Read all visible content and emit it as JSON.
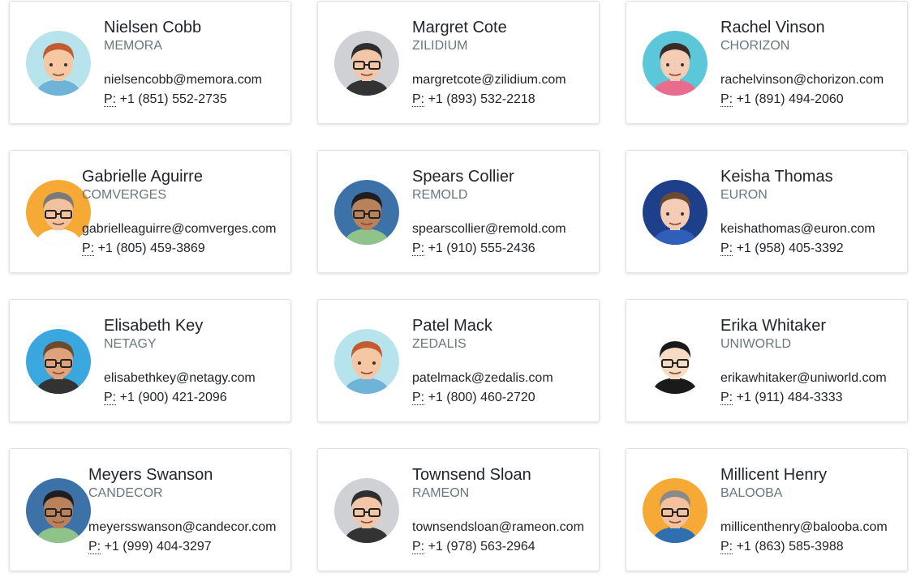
{
  "phone_prefix": "P:",
  "contacts": [
    {
      "name": "Nielsen Cobb",
      "company": "MEMORA",
      "email": "nielsencobb@memora.com",
      "phone": "+1 (851) 552-2735",
      "avatar": "avatar-redhair-man",
      "bg": "#b7e3ec",
      "skin": "#f7c7a3",
      "hair": "#c25b30",
      "shirt": "#6fb3d8",
      "glasses": false
    },
    {
      "name": "Margret Cote",
      "company": "ZILIDIUM",
      "email": "margretcote@zilidium.com",
      "phone": "+1 (893) 532-2218",
      "avatar": "avatar-glasses-man",
      "bg": "#cfd1d5",
      "skin": "#f2c6a6",
      "hair": "#2e2e2e",
      "shirt": "#333333",
      "glasses": true
    },
    {
      "name": "Rachel Vinson",
      "company": "CHORIZON",
      "email": "rachelvinson@chorizon.com",
      "phone": "+1 (891) 494-2060",
      "avatar": "avatar-woman-brown-hair",
      "bg": "#5cc7d9",
      "skin": "#f5cdb4",
      "hair": "#3a2b24",
      "shirt": "#e86c8e",
      "glasses": false
    },
    {
      "name": "Gabrielle Aguirre",
      "company": "COMVERGES",
      "email": "gabrielleaguirre@comverges.com",
      "phone": "+1 (805) 459-3869",
      "avatar": "avatar-bald-glasses-man",
      "bg": "#f7a935",
      "skin": "#f2c29e",
      "hair": "#7a7a7a",
      "shirt": "#ffffff",
      "glasses": true
    },
    {
      "name": "Spears Collier",
      "company": "REMOLD",
      "email": "spearscollier@remold.com",
      "phone": "+1 (910) 555-2436",
      "avatar": "avatar-dark-glasses-man",
      "bg": "#3d72a8",
      "skin": "#b9825a",
      "hair": "#1e1e1e",
      "shirt": "#8fc38a",
      "glasses": true
    },
    {
      "name": "Keisha Thomas",
      "company": "EURON",
      "email": "keishathomas@euron.com",
      "phone": "+1 (958) 405-3392",
      "avatar": "avatar-woman-stars",
      "bg": "#1e3f8a",
      "skin": "#f5cdb4",
      "hair": "#6b4a33",
      "shirt": "#2f5fb8",
      "glasses": false
    },
    {
      "name": "Elisabeth Key",
      "company": "NETAGY",
      "email": "elisabethkey@netagy.com",
      "phone": "+1 (900) 421-2096",
      "avatar": "avatar-sunglasses-man",
      "bg": "#3aa7de",
      "skin": "#e0a27a",
      "hair": "#6b4a2f",
      "shirt": "#333333",
      "glasses": true
    },
    {
      "name": "Patel Mack",
      "company": "ZEDALIS",
      "email": "patelmack@zedalis.com",
      "phone": "+1 (800) 460-2720",
      "avatar": "avatar-redhair-man",
      "bg": "#b7e3ec",
      "skin": "#f7c7a3",
      "hair": "#c25b30",
      "shirt": "#6fb3d8",
      "glasses": false
    },
    {
      "name": "Erika Whitaker",
      "company": "UNIWORLD",
      "email": "erikawhitaker@uniworld.com",
      "phone": "+1 (911) 484-3333",
      "avatar": "avatar-cartoon-glasses-man",
      "bg": "#ffffff",
      "skin": "#f7dcc4",
      "hair": "#1a1a1a",
      "shirt": "#1a1a1a",
      "glasses": true
    },
    {
      "name": "Meyers Swanson",
      "company": "CANDECOR",
      "email": "meyersswanson@candecor.com",
      "phone": "+1 (999) 404-3297",
      "avatar": "avatar-dark-glasses-man",
      "bg": "#3d72a8",
      "skin": "#b9825a",
      "hair": "#1e1e1e",
      "shirt": "#8fc38a",
      "glasses": true
    },
    {
      "name": "Townsend Sloan",
      "company": "RAMEON",
      "email": "townsendsloan@rameon.com",
      "phone": "+1 (978) 563-2964",
      "avatar": "avatar-glasses-man",
      "bg": "#cfd1d5",
      "skin": "#f2c6a6",
      "hair": "#2e2e2e",
      "shirt": "#333333",
      "glasses": true
    },
    {
      "name": "Millicent Henry",
      "company": "BALOOBA",
      "email": "millicenthenry@balooba.com",
      "phone": "+1 (863) 585-3988",
      "avatar": "avatar-grey-hair-glasses-man",
      "bg": "#f7a935",
      "skin": "#f2c29e",
      "hair": "#8a8a8a",
      "shirt": "#2f6fb0",
      "glasses": true
    }
  ]
}
